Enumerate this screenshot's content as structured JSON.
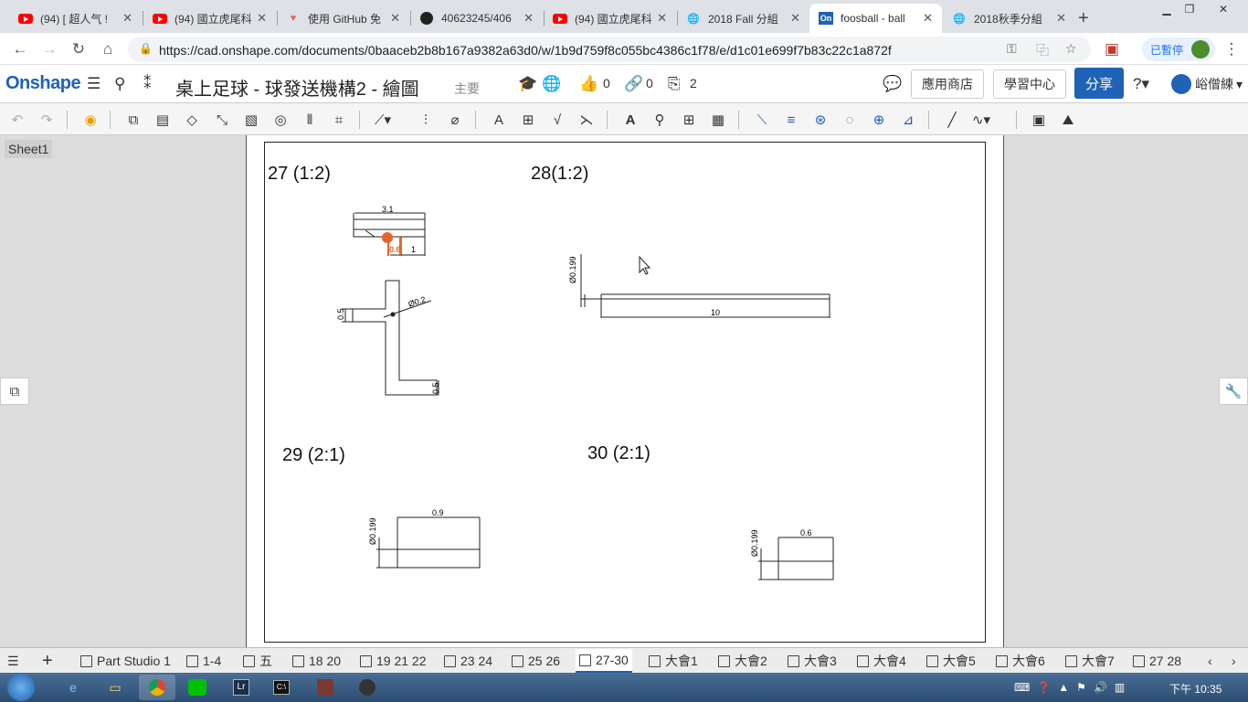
{
  "browser": {
    "tabs": [
      {
        "title": "(94) [ 超人气 !",
        "icon": "youtube-icon"
      },
      {
        "title": "(94) 國立虎尾科",
        "icon": "youtube-icon"
      },
      {
        "title": "使用 GitHub 免",
        "icon": "heart-icon"
      },
      {
        "title": "40623245/406",
        "icon": "github-icon"
      },
      {
        "title": "(94) 國立虎尾科",
        "icon": "youtube-icon"
      },
      {
        "title": "2018 Fall 分組",
        "icon": "globe-icon"
      },
      {
        "title": "foosball - ball",
        "icon": "onshape-icon"
      },
      {
        "title": "2018秋季分組",
        "icon": "globe-icon"
      }
    ],
    "url": "https://cad.onshape.com/documents/0baaceb2b8b167a9382a63d0/w/1b9d759f8c055bc4386c1f78/e/d1c01e699f7b83c22c1a872f",
    "paused_label": "已暫停"
  },
  "onshape": {
    "logo": "Onshape",
    "doc_title": "桌上足球 - 球發送機構2 - 繪圖",
    "branch": "主要",
    "likes": "0",
    "links": "0",
    "copies": "2",
    "app_store": "應用商店",
    "learning_center": "學習中心",
    "share": "分享",
    "user": "峪僧練"
  },
  "sheet": {
    "name": "Sheet1",
    "views": [
      {
        "label": "27  (1:2)"
      },
      {
        "label": "28(1:2)"
      },
      {
        "label": "29   (2:1)"
      },
      {
        "label": "30    (2:1)"
      }
    ],
    "dims": {
      "d31": "3.1",
      "d06": "0.6",
      "d1": "1",
      "d02": "Ø0.2",
      "d05a": "0.5",
      "d05b": "0.5",
      "d0199a": "Ø0.199",
      "d10": "10",
      "d09": "0.9",
      "d0199b": "Ø0.199",
      "d06b": "0.6",
      "d0199c": "Ø0.199"
    }
  },
  "bottom_tabs": [
    {
      "label": "Part Studio 1"
    },
    {
      "label": "1-4"
    },
    {
      "label": "五"
    },
    {
      "label": "18 20"
    },
    {
      "label": "19 21 22"
    },
    {
      "label": "23 24"
    },
    {
      "label": "25 26"
    },
    {
      "label": "27-30",
      "active": true
    },
    {
      "label": "大會1"
    },
    {
      "label": "大會2"
    },
    {
      "label": "大會3"
    },
    {
      "label": "大會4"
    },
    {
      "label": "大會5"
    },
    {
      "label": "大會6"
    },
    {
      "label": "大會7"
    },
    {
      "label": "27 28"
    }
  ],
  "taskbar": {
    "time": "下午 10:35"
  }
}
